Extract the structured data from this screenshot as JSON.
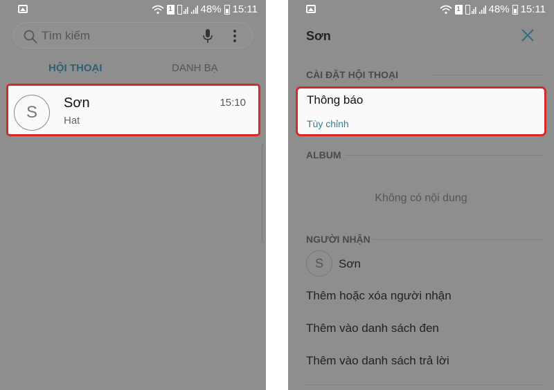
{
  "status_bar": {
    "battery": "48%",
    "time": "15:11",
    "sim": "1"
  },
  "left": {
    "search": {
      "placeholder": "Tìm kiếm"
    },
    "tabs": [
      {
        "label": "HỘI THOẠI"
      },
      {
        "label": "DANH BẠ"
      }
    ],
    "conversation": {
      "avatar_letter": "S",
      "name": "Sơn",
      "preview": "Hat",
      "time": "15:10"
    }
  },
  "right": {
    "title": "Sơn",
    "sections": {
      "conversation_settings": "CÀI ĐẶT HỘI THOẠI",
      "album": "ALBUM",
      "recipients": "NGƯỜI NHẬN"
    },
    "notification": {
      "title": "Thông báo",
      "subtitle": "Tùy chỉnh"
    },
    "album_empty": "Không có nội dung",
    "recipient": {
      "avatar_letter": "S",
      "name": "Sơn"
    },
    "menu": [
      {
        "label": "Thêm hoặc xóa người nhận"
      },
      {
        "label": "Thêm vào danh sách đen"
      },
      {
        "label": "Thêm vào danh sách trả lời"
      }
    ]
  },
  "colors": {
    "highlight_border": "#d22b2b",
    "accent": "#2f7f96",
    "dim_background": "#8e8e8e"
  }
}
